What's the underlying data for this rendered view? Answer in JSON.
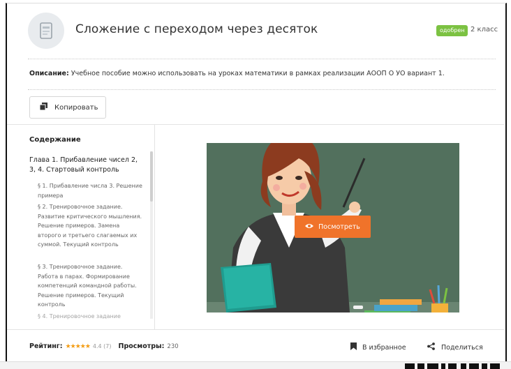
{
  "header": {
    "title": "Сложение с переходом через десяток",
    "badge": "одобрен",
    "grade": "2 класс",
    "doc_icon": "document-icon"
  },
  "description": {
    "label": "Описание:",
    "text": "Учебное пособие можно использовать на уроках математики в рамках реализации АООП О УО вариант 1."
  },
  "actions": {
    "copy_label": "Копировать",
    "view_label": "Посмотреть"
  },
  "toc": {
    "title": "Содержание",
    "chapter": "Глава 1. Прибавление чисел 2, 3, 4. Стартовый контроль",
    "sections": [
      "§ 1. Прибавление числа 3. Решение примера",
      "§ 2. Тренировочное задание. Развитие критического мышления. Решение примеров. Замена второго и третьего слагаемых их суммой. Текущий контроль",
      "§ 3. Тренировочное задание. Работа в парах. Формирование компетенций командной работы. Решение примеров. Текущий контроль",
      "§ 4. Тренировочное задание"
    ]
  },
  "footer": {
    "rating_label": "Рейтинг:",
    "stars": "★★★★★",
    "rating_value": "4.4 (7)",
    "views_label": "Просмотры:",
    "views_value": "230",
    "favorite_label": "В избранное",
    "share_label": "Поделиться"
  },
  "colors": {
    "accent_orange": "#f0732a",
    "badge_green": "#7cc242",
    "star": "#f39c12",
    "board": "#52705d"
  }
}
